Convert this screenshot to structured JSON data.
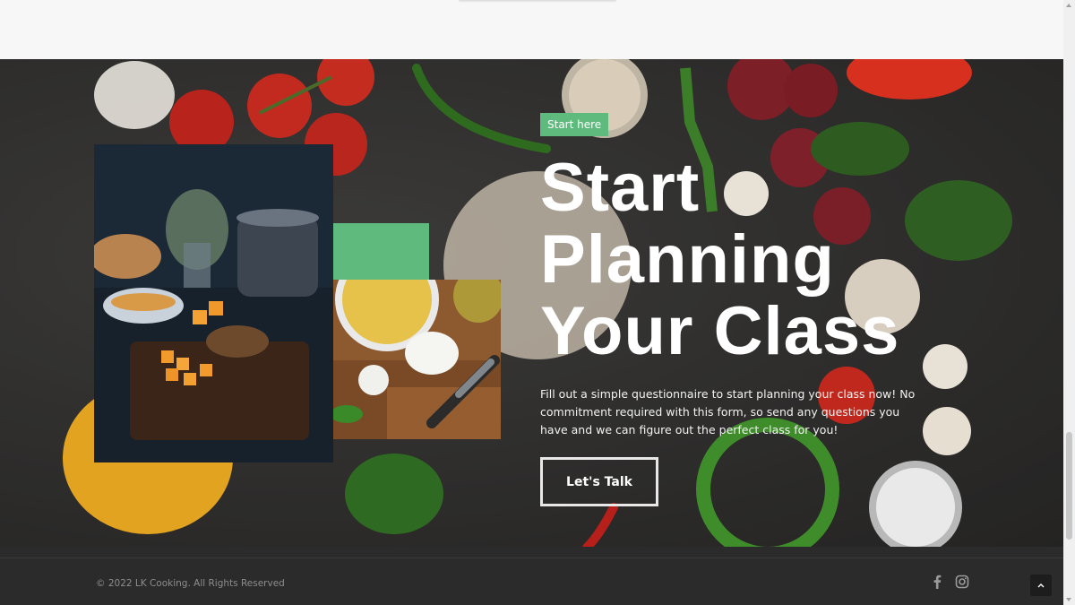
{
  "hero": {
    "tag": "Start here",
    "headline_lines": [
      "Start",
      "Planning",
      "Your Class"
    ],
    "description": "Fill out a simple questionnaire to start planning your class now! No commitment required with this form, so send any questions you have and we can figure out the perfect class for you!",
    "cta_label": "Let's Talk"
  },
  "footer": {
    "copyright": "© 2022 LK Cooking. All Rights Reserved",
    "social": [
      "facebook-icon",
      "instagram-icon"
    ]
  },
  "colors": {
    "accent": "#5fba7d",
    "footer_bg": "#2b2b2b",
    "hero_bg": "#3a3937"
  }
}
